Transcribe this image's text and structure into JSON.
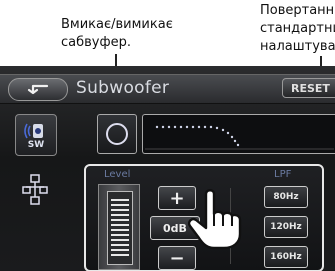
{
  "callouts": {
    "left": "Вмикає/вимикає\nсабвуфер.",
    "right": "Повертанн\nстандартни\nналаштува"
  },
  "header": {
    "title": "Subwoofer",
    "reset_label": "RESET",
    "back_icon": "back-arrow-icon"
  },
  "sidebar": {
    "sw_label": "SW",
    "sw_icon": "subwoofer-speaker-icon",
    "network_icon": "network-icon"
  },
  "power": {
    "icon": "power-ring-icon"
  },
  "level": {
    "label": "Level",
    "plus_label": "+",
    "value": "0dB",
    "minus_label": "−"
  },
  "lpf": {
    "label": "LPF",
    "options": [
      "80Hz",
      "120Hz",
      "160Hz"
    ]
  },
  "colors": {
    "panel_label": "#6a7aa0",
    "curve": "#cfd4e8"
  }
}
